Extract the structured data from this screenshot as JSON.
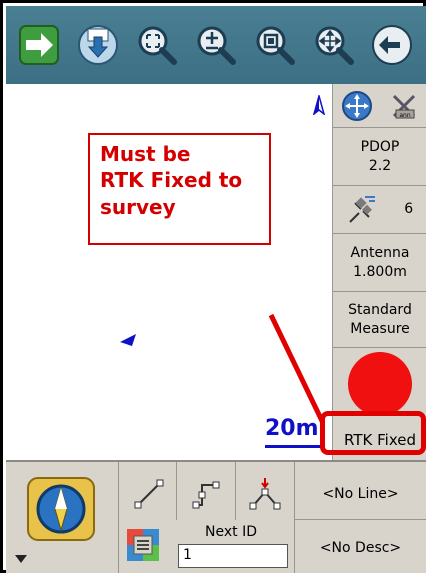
{
  "toolbar": {
    "buttons": [
      {
        "icon": "next-arrow-icon"
      },
      {
        "icon": "download-map-icon"
      },
      {
        "icon": "zoom-extents-icon"
      },
      {
        "icon": "zoom-in-out-icon"
      },
      {
        "icon": "zoom-window-icon"
      },
      {
        "icon": "pan-icon"
      },
      {
        "icon": "back-arrow-icon"
      }
    ]
  },
  "map": {
    "scale_label": "20m"
  },
  "callout": {
    "lines": [
      "Must be",
      "RTK Fixed to",
      "survey"
    ]
  },
  "status_panel": {
    "pdop_label": "PDOP",
    "pdop_value": "2.2",
    "satellites": "6",
    "antenna_label": "Antenna",
    "antenna_value": "1.800m",
    "mode_line1": "Standard",
    "mode_line2": "Measure",
    "status_text": "RTK Fixed",
    "status_color": "#f01010"
  },
  "bottom": {
    "next_id_label": "Next ID",
    "next_id_value": "1",
    "line_button": "<No Line>",
    "desc_button": "<No Desc>"
  },
  "colors": {
    "toolbar": "#4a7f93",
    "panel": "#d8d4cc",
    "callout": "#d40000",
    "scale": "#1010c8"
  }
}
